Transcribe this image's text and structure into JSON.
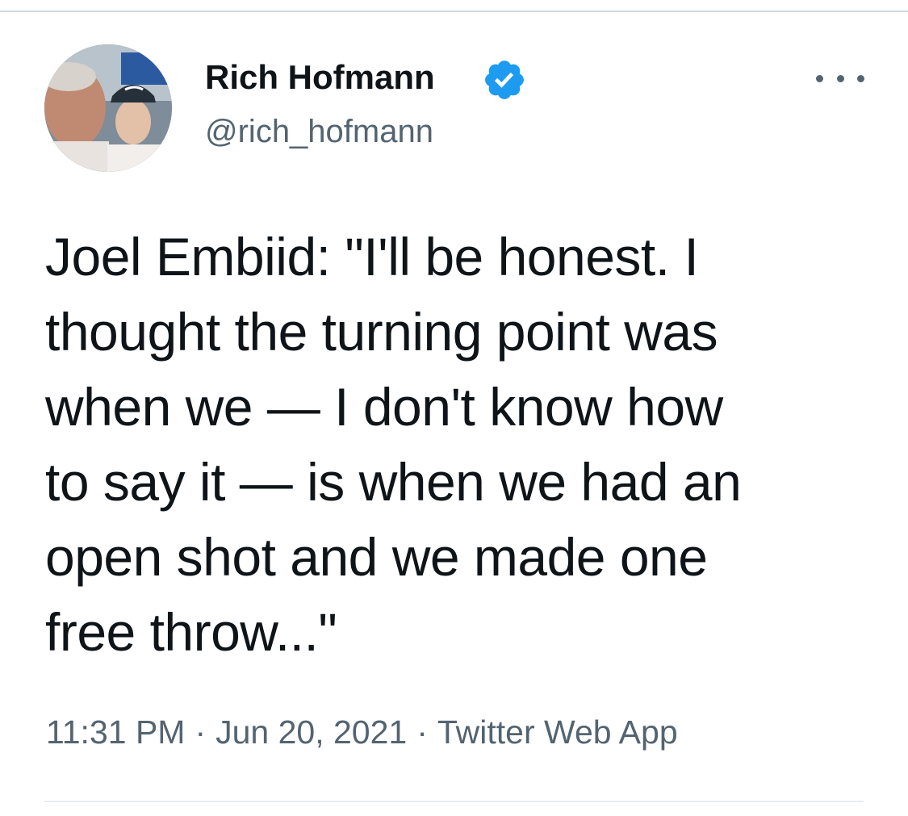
{
  "tweet": {
    "author": {
      "display_name": "Rich Hofmann",
      "handle": "@rich_hofmann",
      "verified": true,
      "avatar_icon": "avatar-photo"
    },
    "text_lines": [
      "Joel Embiid: \"I'll be honest. I",
      "thought the turning point was",
      "when we — I don't know how",
      "to say it — is when we had an",
      "open shot and we made one",
      "free throw...\""
    ],
    "time": "11:31 PM",
    "separator": "·",
    "date": "Jun 20, 2021",
    "source": "Twitter Web App",
    "more_icon": "more-horizontal-icon"
  },
  "colors": {
    "text_primary": "#0f1419",
    "text_secondary": "#536471",
    "verified_blue": "#1d9bf0",
    "divider": "#cfd9de"
  }
}
